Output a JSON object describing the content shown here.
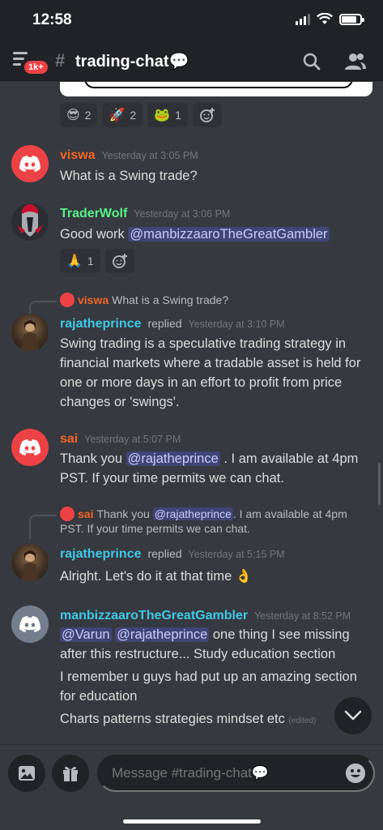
{
  "status_bar": {
    "time": "12:58"
  },
  "header": {
    "badge": "1k+",
    "hash": "#",
    "channel_title": "trading-chat💬"
  },
  "reactions_top": [
    {
      "emoji": "😎",
      "count": "2"
    },
    {
      "emoji": "🚀",
      "count": "2"
    },
    {
      "emoji": "🐸",
      "count": "1"
    }
  ],
  "messages": [
    {
      "author": "viswa",
      "author_color": "#f26522",
      "timestamp": "Yesterday at 3:05 PM",
      "text": "What is a Swing trade?"
    },
    {
      "author": "TraderWolf",
      "author_color": "#57f287",
      "timestamp": "Yesterday at 3:06 PM",
      "text_prefix": "Good work ",
      "mention": "@manbizzaaroTheGreatGambler",
      "reaction": {
        "emoji": "🙏",
        "count": "1"
      }
    },
    {
      "reply_to": {
        "author": "viswa",
        "text": "What is a Swing trade?"
      },
      "author": "rajatheprince",
      "author_color": "#3ec9e6",
      "replied": "replied",
      "timestamp": "Yesterday at 3:10 PM",
      "text": "Swing trading is a speculative trading strategy in financial markets where a tradable asset is held for one or more days in an effort to profit from price changes or 'swings'."
    },
    {
      "author": "sai",
      "author_color": "#f26522",
      "timestamp": "Yesterday at 5:07 PM",
      "text_prefix": "Thank you ",
      "mention": "@rajatheprince",
      "text_suffix": " . I am available at 4pm PST. If your time permits we can chat."
    },
    {
      "reply_to": {
        "author": "sai",
        "text_prefix": "Thank you ",
        "mention": "@rajatheprince",
        "text_suffix": ". I am available at 4pm PST. If your time permits we can chat."
      },
      "author": "rajatheprince",
      "author_color": "#3ec9e6",
      "replied": "replied",
      "timestamp": "Yesterday at 5:15 PM",
      "text": "Alright. Let's do it at that time 👌"
    },
    {
      "author": "manbizzaaroTheGreatGambler",
      "author_color": "#3ec9e6",
      "timestamp": "Yesterday at 8:52 PM",
      "mention1": "@Varun",
      "mention2": "@rajatheprince",
      "line1_suffix": " one thing I see missing after this restructure... Study education section",
      "line2": "I remember u guys had put up an amazing section for education",
      "line3": "Charts patterns strategies mindset etc",
      "edited": "(edited)"
    }
  ],
  "composer": {
    "placeholder": "Message #trading-chat💬"
  }
}
